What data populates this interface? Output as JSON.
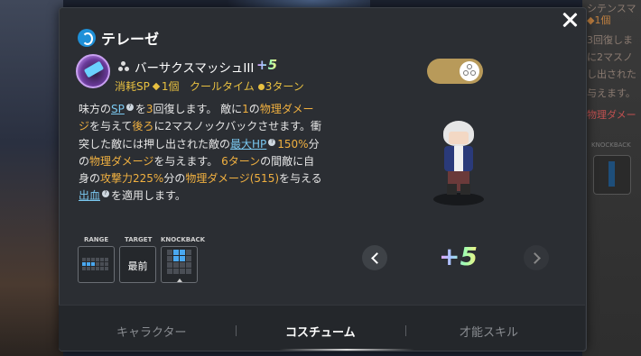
{
  "header": {
    "title": "テレーゼ"
  },
  "skill": {
    "name": "バーサクスマッシュIII",
    "plus": "+5",
    "cost_label": "消耗SP",
    "cost_value": "1個",
    "cooldown_label": "クールタイム",
    "cooldown_value": "3ターン"
  },
  "description": {
    "s1": "味方の",
    "sp": "SP",
    "s2": "を",
    "n3": "3",
    "s3": "回復します。 敵に",
    "n1": "1",
    "s4": "の",
    "phys1": "物理ダメージ",
    "s5": "を与えて",
    "after": "後ろ",
    "s6": "に2マスノックバックさせます。衝突した敵には押し出された敵の",
    "maxhp": "最大HP",
    "pct150": "150%",
    "s7": "分の",
    "phys2": "物理ダメージ",
    "s8": "を与えます。",
    "turns6": "6ターン",
    "s9": "の間敵に自身の",
    "atk225": "攻撃力225%",
    "s10": "分の",
    "phys3": "物理ダメージ(515)",
    "s11": "を与える",
    "bleed": "出血",
    "s12": "を適用します。"
  },
  "stats": {
    "range_label": "RANGE",
    "target_label": "TARGET",
    "target_value": "最前",
    "knockback_label": "KNOCKBACK"
  },
  "costume": {
    "plus": "+5",
    "toggle_on": true
  },
  "tabs": [
    {
      "label": "キャラクター",
      "active": false
    },
    {
      "label": "コスチューム",
      "active": true
    },
    {
      "label": "才能スキル",
      "active": false
    }
  ],
  "background": {
    "lines": [
      "シテンスマ",
      "◆1個",
      "3回復しま",
      "に2マスノ",
      "し出された",
      "与えます。",
      "物理ダメー"
    ],
    "knockback_label": "KNOCKBACK"
  },
  "colors": {
    "accent_gold": "#e8c040",
    "link_blue": "#7ac8f0",
    "toggle": "#b89a5a"
  }
}
